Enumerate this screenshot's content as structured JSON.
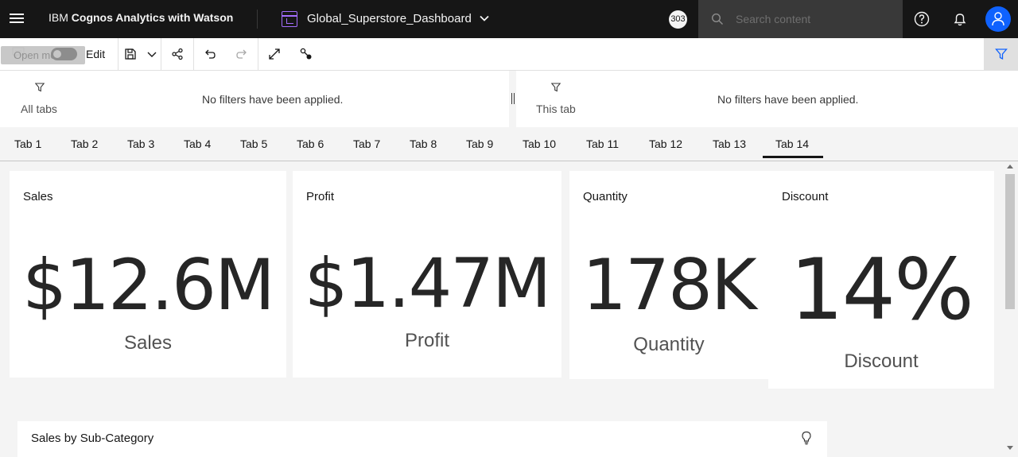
{
  "app": {
    "brand_prefix": "IBM ",
    "brand_bold": "Cognos Analytics with Watson",
    "dashboard_title": "Global_Superstore_Dashboard",
    "counter_badge": "303",
    "search_placeholder": "Search content"
  },
  "toolbar": {
    "tooltip": "Open menu",
    "edit_label": "Edit"
  },
  "filters": {
    "all_tabs_label": "All tabs",
    "all_tabs_message": "No filters have been applied.",
    "this_tab_label": "This tab",
    "this_tab_message": "No filters have been applied."
  },
  "tabs": [
    {
      "label": "Tab 1"
    },
    {
      "label": "Tab 2"
    },
    {
      "label": "Tab 3"
    },
    {
      "label": "Tab 4"
    },
    {
      "label": "Tab 5"
    },
    {
      "label": "Tab 6"
    },
    {
      "label": "Tab 7"
    },
    {
      "label": "Tab 8"
    },
    {
      "label": "Tab 9"
    },
    {
      "label": "Tab 10"
    },
    {
      "label": "Tab 11"
    },
    {
      "label": "Tab 12"
    },
    {
      "label": "Tab 13"
    },
    {
      "label": "Tab 14"
    }
  ],
  "active_tab": "Tab 14",
  "kpis": [
    {
      "title": "Sales",
      "value": "$12.6M",
      "caption": "Sales"
    },
    {
      "title": "Profit",
      "value": "$1.47M",
      "caption": "Profit"
    },
    {
      "title": "Quantity",
      "value": "178K",
      "caption": "Quantity"
    },
    {
      "title": "Discount",
      "value": "14%",
      "caption": "Discount"
    }
  ],
  "bottom_widget": {
    "title": "Sales by Sub-Category"
  },
  "colors": {
    "topbar": "#161616",
    "accent_blue": "#0f62fe",
    "dashboard_icon": "#a56eff"
  }
}
